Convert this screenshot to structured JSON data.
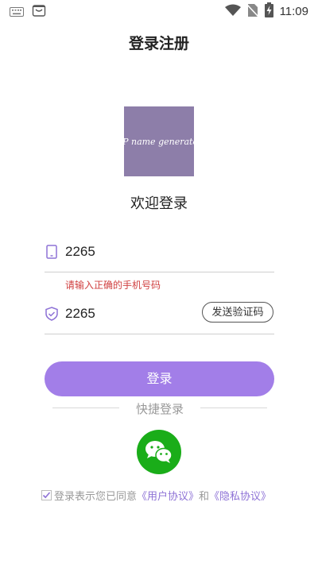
{
  "status_bar": {
    "time": "11:09",
    "icons": [
      "keyboard-icon",
      "shop-bag-icon",
      "wifi-icon",
      "no-sim-icon",
      "battery-charging-icon"
    ]
  },
  "header": {
    "title": "登录注册"
  },
  "logo": {
    "text": "CP name generator",
    "bg_color": "#8d7ea9"
  },
  "welcome_text": "欢迎登录",
  "form": {
    "phone_value": "2265",
    "phone_error": "请输入正确的手机号码",
    "code_value": "2265",
    "send_code_label": "发送验证码",
    "login_label": "登录"
  },
  "quick_login": {
    "label": "快捷登录",
    "wechat_icon": "wechat-icon"
  },
  "agreement": {
    "checked": true,
    "prefix": "登录表示您已同意",
    "user_agreement": "《用户协议》",
    "and": "和",
    "privacy_agreement": "《隐私协议》"
  },
  "colors": {
    "accent": "#a27ee8",
    "link": "#8e72d6",
    "error": "#d04040",
    "wechat": "#1aad19"
  }
}
